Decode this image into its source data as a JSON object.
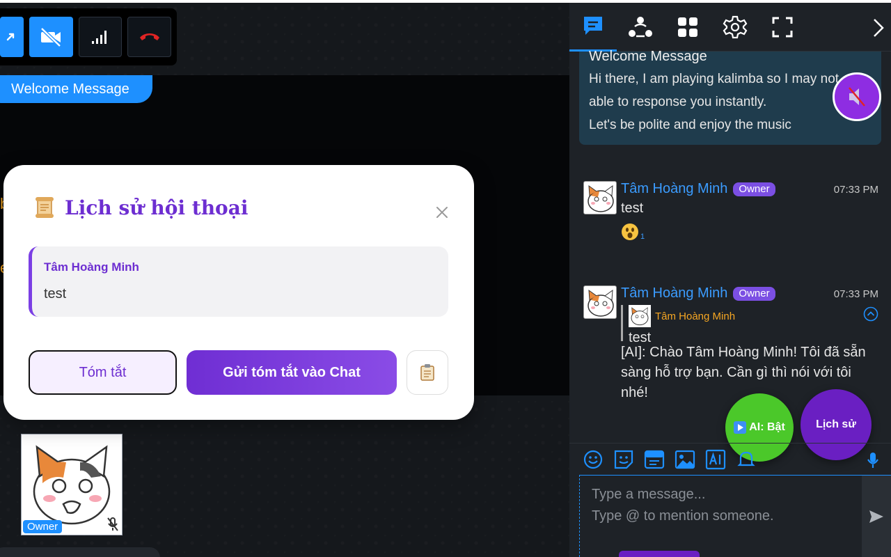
{
  "stage": {
    "welcome_label": "Welcome Message",
    "edge_glyph_1": "b",
    "edge_glyph_2": "e",
    "tile_role": "Owner"
  },
  "toolbar": {
    "buttons": [
      "share-screen",
      "camera-off",
      "network-signal",
      "hang-up"
    ]
  },
  "modal": {
    "title": "Lịch sử hội thoại",
    "message": {
      "name": "Tâm Hoàng Minh",
      "text": "test"
    },
    "summary_button": "Tóm tắt",
    "send_button": "Gửi tóm tắt vào Chat"
  },
  "panel": {
    "welcome": {
      "title": "Welcome Message",
      "lines": [
        "Hi there, I am playing kalimba so I may not",
        "able to response you instantly.",
        "Let's be polite and enjoy the music"
      ]
    },
    "messages": [
      {
        "name": "Tâm Hoàng Minh",
        "badge": "Owner",
        "time": "07:33 PM",
        "text": "test",
        "reaction_count": "1"
      },
      {
        "name": "Tâm Hoàng Minh",
        "badge": "Owner",
        "time": "07:33 PM",
        "quote_name": "Tâm Hoàng Minh",
        "quote_text": "test",
        "text": "[AI]: Chào Tâm Hoàng Minh! Tôi đã sẵn sàng hỗ trợ bạn. Cần gì thì nói với tôi nhé!"
      }
    ],
    "ai_fab_label": "AI: Bật",
    "history_fab_label": "Lịch sử",
    "compose": {
      "placeholder_line1": "Type a message...",
      "placeholder_line2": "Type @ to mention someone."
    }
  },
  "colors": {
    "accent": "#1e90ff",
    "purple": "#6d2ed1",
    "green": "#4bc82a",
    "panel_bg": "#1e2227"
  }
}
